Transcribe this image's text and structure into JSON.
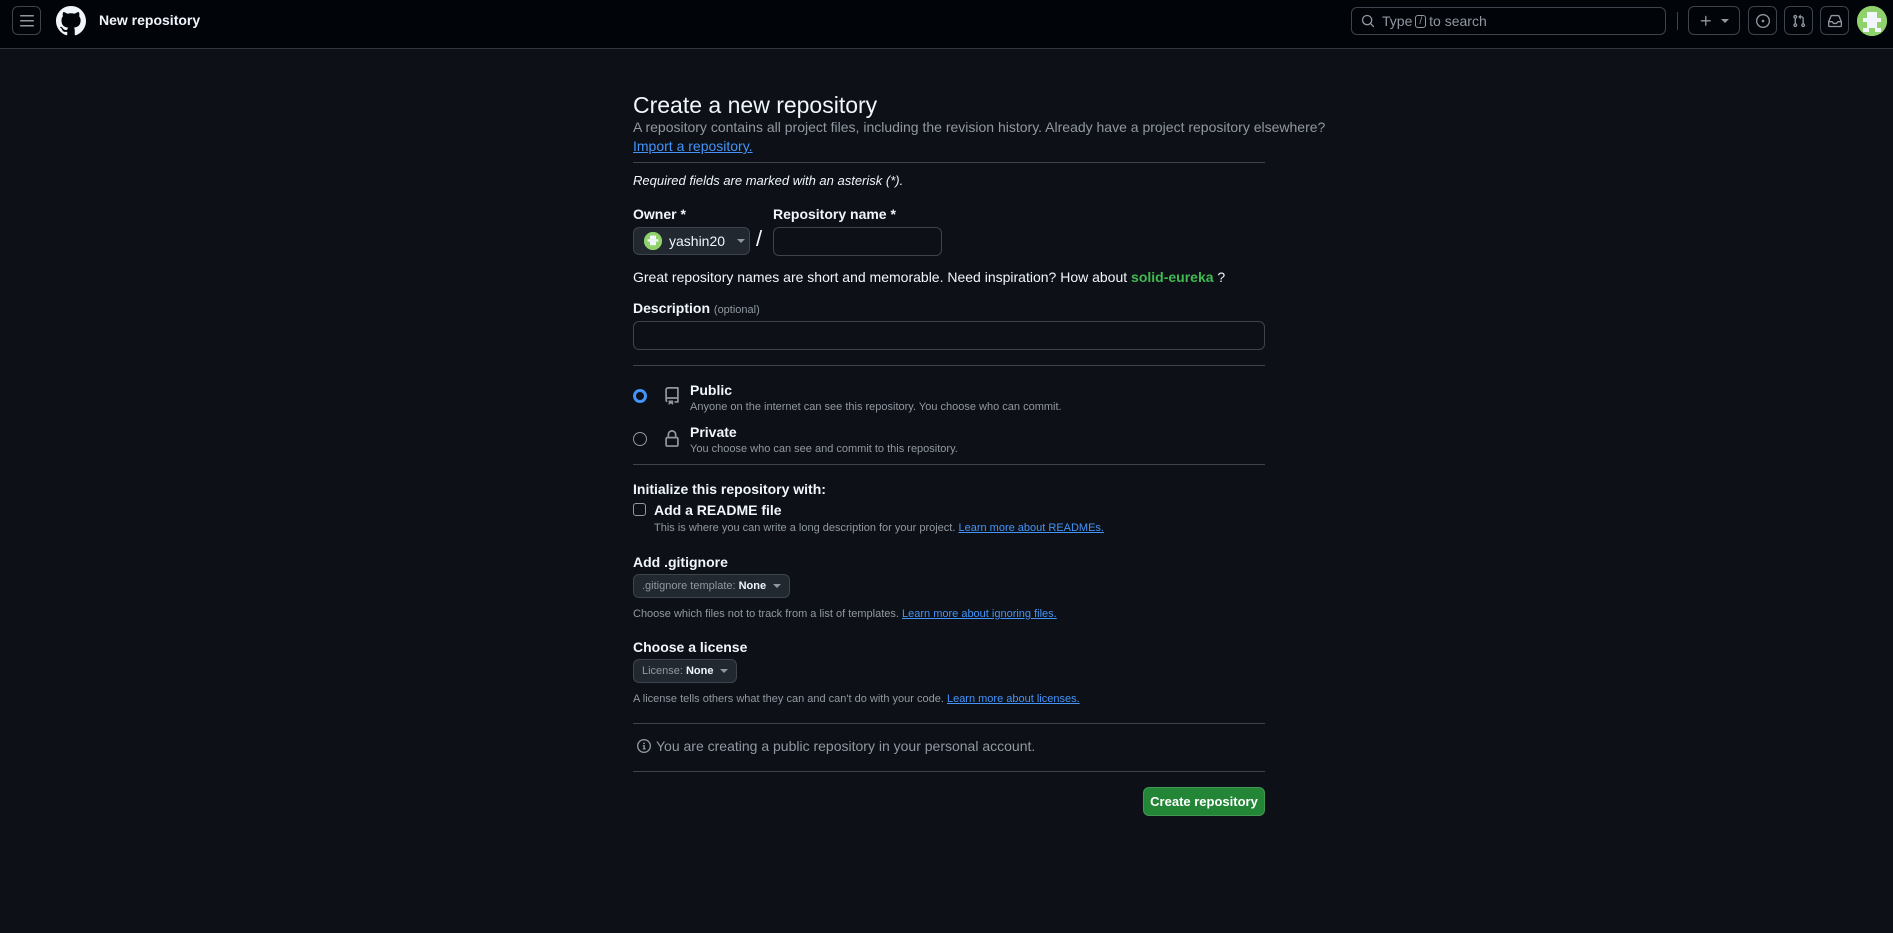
{
  "header": {
    "page_context": "New repository",
    "search_placeholder_prefix": "Type",
    "search_key": "/",
    "search_placeholder_suffix": "to search",
    "icons": [
      "menu-icon",
      "github-logo-icon",
      "search-icon",
      "plus-icon",
      "chevron-down-icon",
      "issues-icon",
      "pull-requests-icon",
      "inbox-icon",
      "avatar"
    ]
  },
  "form": {
    "title": "Create a new repository",
    "subtitle": "A repository contains all project files, including the revision history. Already have a project repository elsewhere?",
    "import_link": "Import a repository.",
    "required_note": "Required fields are marked with an asterisk (*).",
    "owner_label": "Owner *",
    "owner_value": "yashin20",
    "repo_name_label": "Repository name *",
    "repo_name_value": "",
    "hint_prefix": "Great repository names are short and memorable. Need inspiration? How about",
    "hint_suggestion": "solid-eureka",
    "hint_suffix": "?",
    "description_label": "Description",
    "description_optional": "(optional)",
    "description_value": "",
    "visibility": {
      "selected": "Public",
      "options": [
        {
          "title": "Public",
          "desc": "Anyone on the internet can see this repository. You choose who can commit."
        },
        {
          "title": "Private",
          "desc": "You choose who can see and commit to this repository."
        }
      ]
    },
    "init_label": "Initialize this repository with:",
    "readme_label": "Add a README file",
    "readme_checked": false,
    "readme_desc": "This is where you can write a long description for your project.",
    "readme_link": "Learn more about READMEs.",
    "gitignore_label": "Add .gitignore",
    "gitignore_select_prefix": ".gitignore template:",
    "gitignore_select_value": "None",
    "gitignore_desc": "Choose which files not to track from a list of templates.",
    "gitignore_link": "Learn more about ignoring files.",
    "license_label": "Choose a license",
    "license_select_prefix": "License:",
    "license_select_value": "None",
    "license_desc": "A license tells others what they can and can't do with your code.",
    "license_link": "Learn more about licenses.",
    "info_text": "You are creating a public repository in your personal account.",
    "create_button": "Create repository"
  },
  "colors": {
    "background": "#0d1117",
    "header_background": "#010409",
    "primary_button": "#238636",
    "link": "#4493f8",
    "suggestion": "#3fb950"
  }
}
